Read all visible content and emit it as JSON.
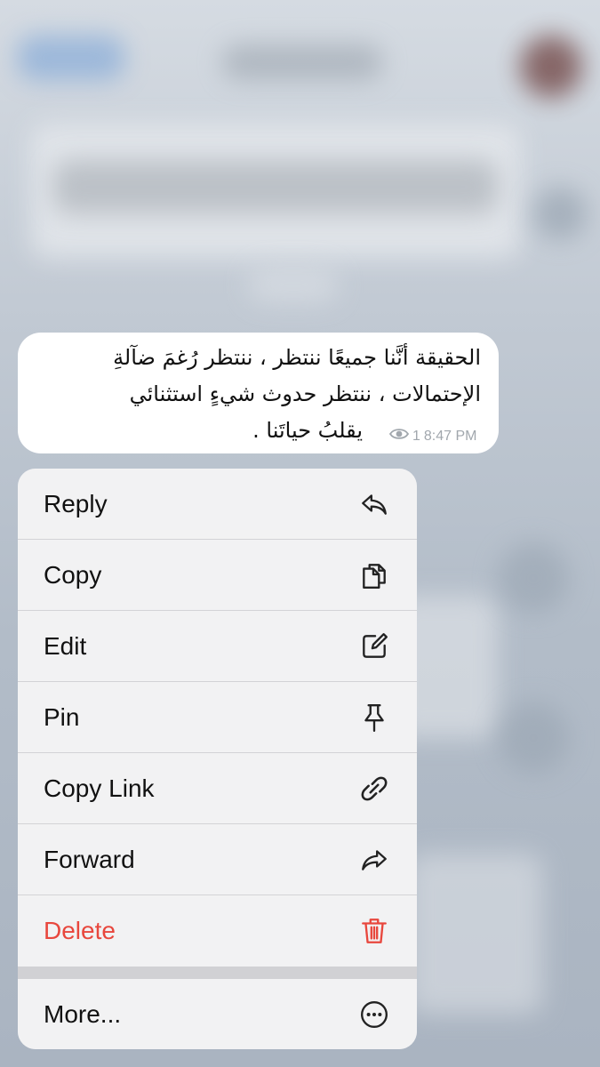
{
  "message": {
    "lines": [
      "الحقيقة أنَّنا جميعًا ننتظر ، ننتظر رُغمَ ضآلةِ",
      "الإحتمالات ، ننتظر حدوث شيءٍ استثنائي",
      "يقلبُ حياتَنا ."
    ],
    "views": "1",
    "time": "8:47 PM"
  },
  "menu": {
    "items": [
      {
        "label": "Reply",
        "icon": "reply-icon"
      },
      {
        "label": "Copy",
        "icon": "copy-icon"
      },
      {
        "label": "Edit",
        "icon": "edit-icon"
      },
      {
        "label": "Pin",
        "icon": "pin-icon"
      },
      {
        "label": "Copy Link",
        "icon": "link-icon"
      },
      {
        "label": "Forward",
        "icon": "forward-icon"
      },
      {
        "label": "Delete",
        "icon": "trash-icon",
        "color": "#e8473d"
      }
    ],
    "more": {
      "label": "More...",
      "icon": "more-icon"
    }
  }
}
